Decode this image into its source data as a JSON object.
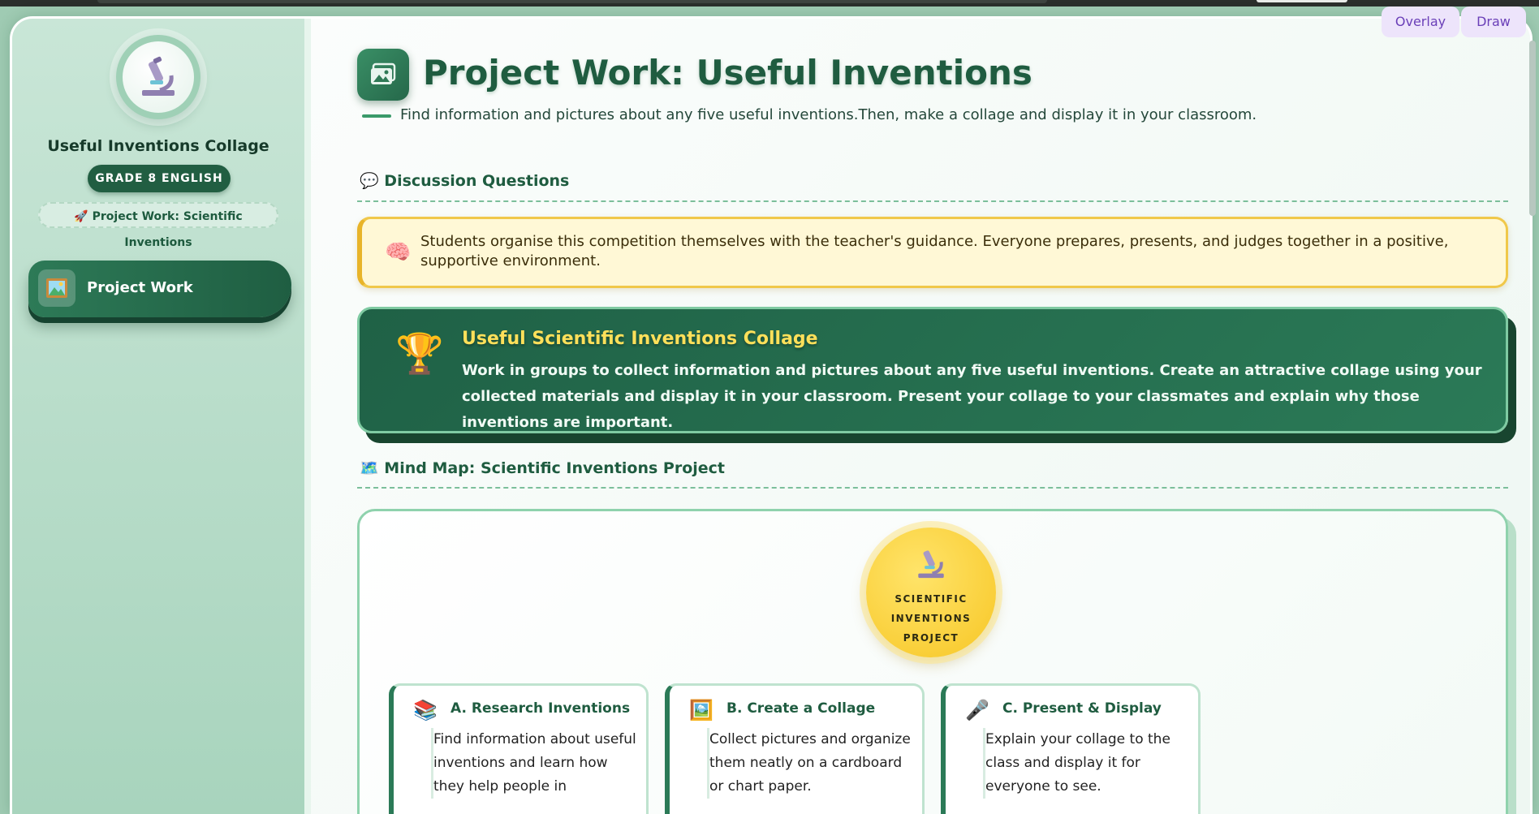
{
  "toolbar": {
    "overlay_label": "Overlay",
    "draw_label": "Draw"
  },
  "sidebar": {
    "logo_icon": "microscope-icon",
    "title": "Useful Inventions Collage",
    "grade_badge": "GRADE 8 ENGLISH",
    "chip_icon": "rocket-icon",
    "chip_label": "Project Work: Scientific Inventions",
    "nav": [
      {
        "icon": "framed-picture-icon",
        "label": "Project Work"
      }
    ]
  },
  "header": {
    "icon": "picture-icon",
    "title": "Project Work: Useful Inventions",
    "subtitle": "Find information and pictures about any five useful inventions.Then, make a collage and display it in your classroom."
  },
  "discussion": {
    "icon": "speech-bubble-icon",
    "title": "Discussion Questions",
    "note_icon": "brain-icon",
    "note": "Students organise this competition themselves with the teacher's guidance. Everyone prepares, presents, and judges together in a positive, supportive environment."
  },
  "task_card": {
    "icon": "trophy-icon",
    "title": "Useful Scientific Inventions Collage",
    "body": "Work in groups to collect information and pictures about any five useful inventions. Create an attractive collage using your collected materials and display it in your classroom. Present your collage to your classmates and explain why those inventions are important."
  },
  "mindmap": {
    "icon": "map-icon",
    "title": "Mind Map: Scientific Inventions Project",
    "center": {
      "icon": "microscope-icon",
      "label": "SCIENTIFIC INVENTIONS PROJECT"
    },
    "branches": [
      {
        "icon": "books-icon",
        "title": "A. Research Inventions",
        "text": "Find information about useful inventions and learn how they help people in"
      },
      {
        "icon": "framed-picture-icon",
        "title": "B. Create a Collage",
        "text": "Collect pictures and organize them neatly on a cardboard or chart paper."
      },
      {
        "icon": "microphone-icon",
        "title": "C. Present & Display",
        "text": "Explain your collage to the class and display it for everyone to see."
      }
    ]
  },
  "colors": {
    "primary": "#1f5c40",
    "accent": "#ffe05a",
    "note_bg": "#fff8d6",
    "toolbar": "#6a3fb8"
  }
}
